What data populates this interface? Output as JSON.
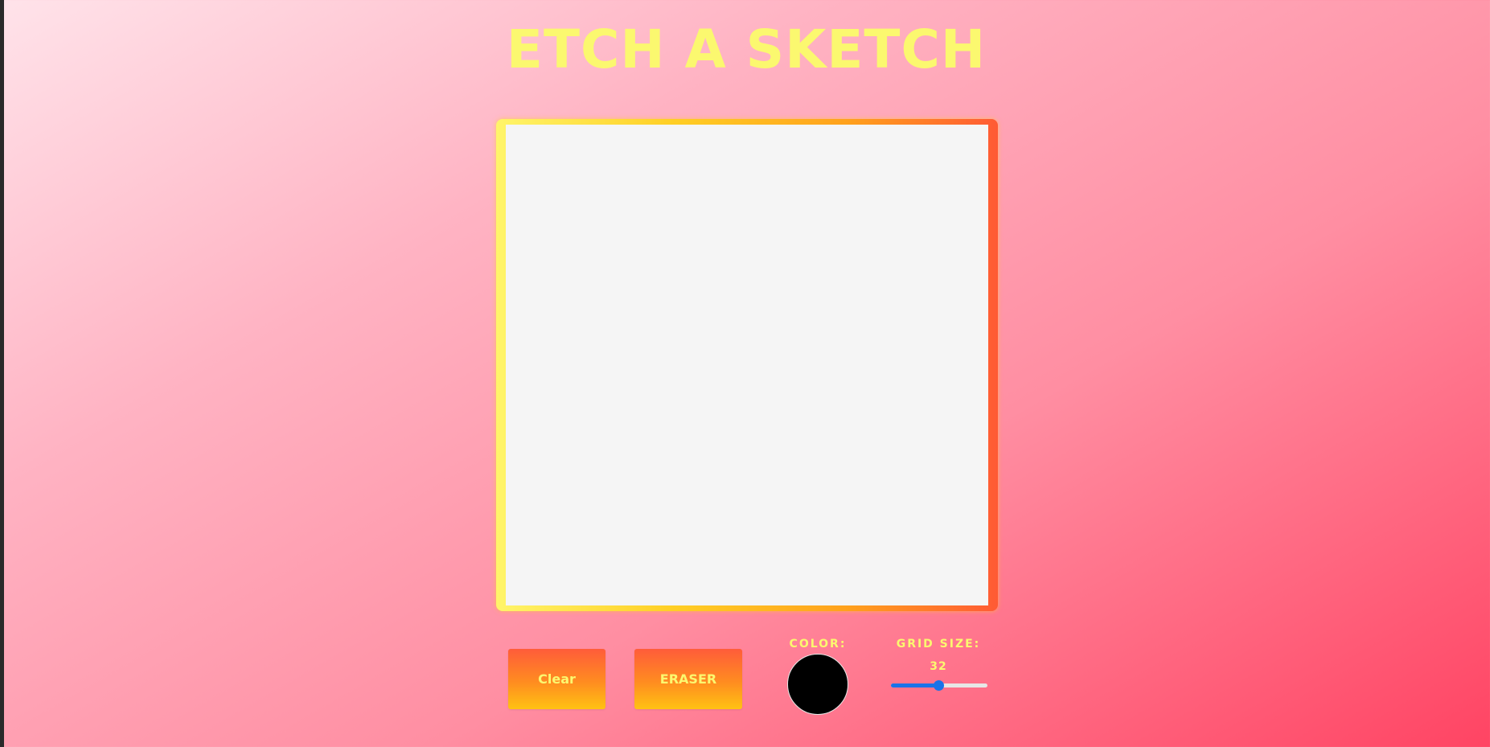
{
  "app": {
    "title": "ETCH A SKETCH"
  },
  "controls": {
    "clear_label": "Clear",
    "eraser_label": "ERASER",
    "color_label": "COLOR:",
    "grid_label": "GRID SIZE:",
    "grid_value": "32"
  },
  "color_picker": {
    "value": "#000000"
  },
  "grid_slider": {
    "min": 1,
    "max": 64,
    "value": 32
  },
  "colors": {
    "title": "#fbf86f",
    "canvas": "#f5f5f5",
    "slider_accent": "#1a73e8"
  }
}
